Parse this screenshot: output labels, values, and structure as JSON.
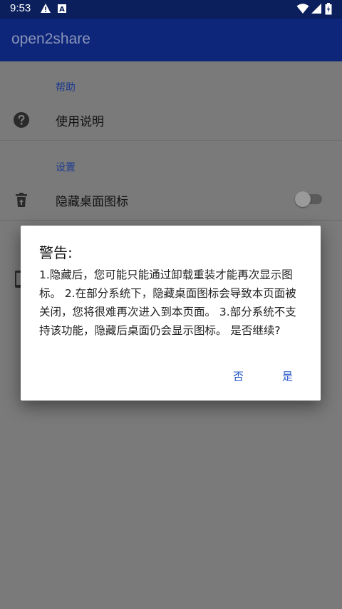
{
  "status_bar": {
    "time": "9:53",
    "icons": [
      "warning-icon",
      "a-icon",
      "wifi-icon",
      "signal-icon",
      "battery-icon"
    ]
  },
  "app_bar": {
    "title": "open2share"
  },
  "sections": {
    "help": {
      "header": "帮助",
      "item_label": "使用说明",
      "icon": "help-icon"
    },
    "settings": {
      "header": "设置",
      "item_label": "隐藏桌面图标",
      "icon": "trash-icon",
      "toggle_on": false
    }
  },
  "dialog": {
    "title": "警告:",
    "message": "1.隐藏后，您可能只能通过卸载重装才能再次显示图标。 2.在部分系统下，隐藏桌面图标会导致本页面被关闭，您将很难再次进入到本页面。 3.部分系统不支持该功能，隐藏后桌面仍会显示图标。 是否继续?",
    "negative_button": "否",
    "positive_button": "是"
  },
  "colors": {
    "status_bar": "#0a1f5c",
    "app_bar": "#0d267a",
    "accent": "#2456c7",
    "scrim": "#7a7a7a"
  }
}
